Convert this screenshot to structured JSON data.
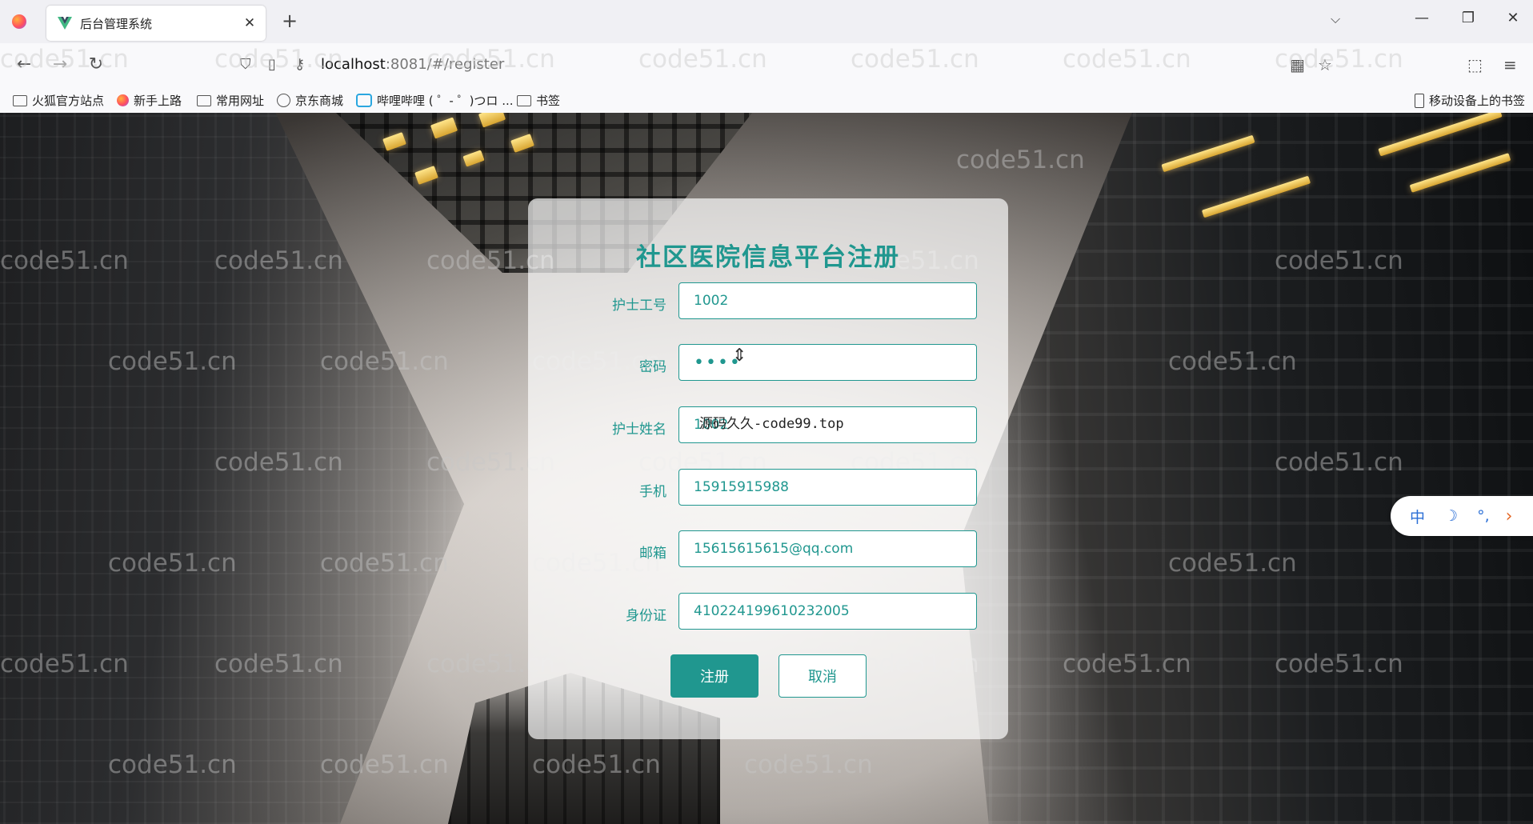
{
  "browser": {
    "tab_title": "后台管理系统",
    "tab_close": "✕",
    "new_tab": "+",
    "tab_list": "⌵",
    "url_host": "localhost",
    "url_path": ":8081/#/register",
    "window_minimize": "—",
    "window_restore": "❐",
    "window_close": "✕",
    "bookmarks": [
      {
        "label": "火狐官方站点",
        "icon": "folder-icon"
      },
      {
        "label": "新手上路",
        "icon": "firefox-icon"
      },
      {
        "label": "常用网址",
        "icon": "folder-icon"
      },
      {
        "label": "京东商城",
        "icon": "globe-icon"
      },
      {
        "label": "哔哩哔哩 ( ゜- ゜)つロ ...",
        "icon": "bilibili-icon"
      },
      {
        "label": "书签",
        "icon": "folder-icon"
      }
    ],
    "mobile_bookmarks": "移动设备上的书签"
  },
  "watermark": "code51.cn",
  "form": {
    "title": "社区医院信息平台注册",
    "fields": [
      {
        "label": "护士工号",
        "value": "1002",
        "type": "text"
      },
      {
        "label": "密码",
        "value": "1002",
        "type": "password"
      },
      {
        "label": "护士姓名",
        "value": "1002",
        "type": "text"
      },
      {
        "label": "手机",
        "value": "15915915988",
        "type": "text"
      },
      {
        "label": "邮箱",
        "value": "15615615615@qq.com",
        "type": "text"
      },
      {
        "label": "身份证",
        "value": "410224199610232005",
        "type": "text"
      }
    ],
    "overlay_text": "源码久久-code99.top",
    "register_label": "注册",
    "cancel_label": "取消"
  },
  "ime": {
    "lang": "中",
    "moon": "☽",
    "punct": "°,",
    "arrow": "›"
  },
  "colors": {
    "accent": "#20978f",
    "chrome_bg": "#f0f0f4"
  }
}
